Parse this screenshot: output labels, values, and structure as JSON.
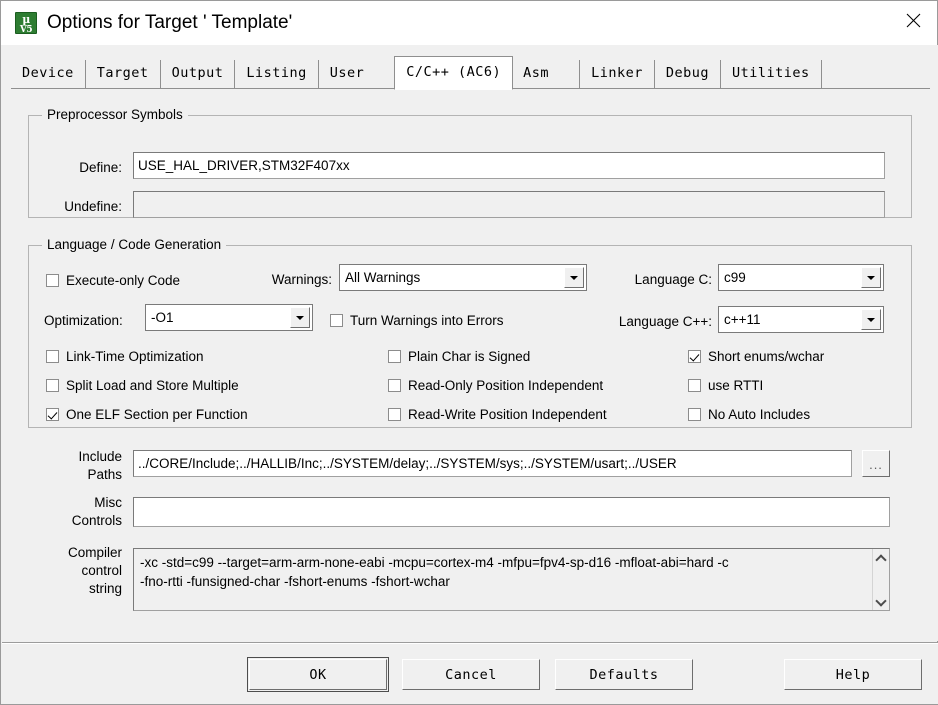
{
  "window": {
    "title": "Options for Target ' Template'",
    "app_icon": "keil-uvision-icon",
    "icon_line1": "µ",
    "icon_line2": "V5",
    "close_label": "✕"
  },
  "tabs": [
    {
      "label": "Device",
      "active": false
    },
    {
      "label": "Target",
      "active": false
    },
    {
      "label": "Output",
      "active": false
    },
    {
      "label": "Listing",
      "active": false
    },
    {
      "label": "User",
      "active": false
    },
    {
      "label": "C/C++ (AC6)",
      "active": true
    },
    {
      "label": "Asm",
      "active": false
    },
    {
      "label": "Linker",
      "active": false
    },
    {
      "label": "Debug",
      "active": false
    },
    {
      "label": "Utilities",
      "active": false
    }
  ],
  "preprocessor": {
    "legend": "Preprocessor Symbols",
    "define_label": "Define:",
    "define_value": "USE_HAL_DRIVER,STM32F407xx",
    "undefine_label": "Undefine:",
    "undefine_value": ""
  },
  "language": {
    "legend": "Language / Code Generation",
    "execute_only": {
      "label": "Execute-only Code",
      "checked": false
    },
    "optimization": {
      "label": "Optimization:",
      "value": "-O1"
    },
    "link_time_opt": {
      "label": "Link-Time Optimization",
      "checked": false
    },
    "split_load_store": {
      "label": "Split Load and Store Multiple",
      "checked": false
    },
    "one_elf_section": {
      "label": "One ELF Section per Function",
      "checked": true
    },
    "warnings": {
      "label": "Warnings:",
      "value": "All Warnings"
    },
    "warnings_errors": {
      "label": "Turn Warnings into Errors",
      "checked": false
    },
    "plain_char_signed": {
      "label": "Plain Char is Signed",
      "checked": false
    },
    "read_only_pi": {
      "label": "Read-Only Position Independent",
      "checked": false
    },
    "read_write_pi": {
      "label": "Read-Write Position Independent",
      "checked": false
    },
    "language_c": {
      "label": "Language C:",
      "value": "c99"
    },
    "language_cpp": {
      "label": "Language C++:",
      "value": "c++11"
    },
    "short_enums": {
      "label": "Short enums/wchar",
      "checked": true
    },
    "use_rtti": {
      "label": "use RTTI",
      "checked": false
    },
    "no_auto_includes": {
      "label": "No Auto Includes",
      "checked": false
    }
  },
  "paths": {
    "include_label_line1": "Include",
    "include_label_line2": "Paths",
    "include_value": "../CORE/Include;../HALLIB/Inc;../SYSTEM/delay;../SYSTEM/sys;../SYSTEM/usart;../USER",
    "browse_label": "...",
    "misc_label_line1": "Misc",
    "misc_label_line2": "Controls",
    "misc_value": ""
  },
  "compiler": {
    "label_line1": "Compiler",
    "label_line2": "control",
    "label_line3": "string",
    "value": "-xc -std=c99 --target=arm-arm-none-eabi -mcpu=cortex-m4 -mfpu=fpv4-sp-d16 -mfloat-abi=hard -c\n-fno-rtti -funsigned-char -fshort-enums -fshort-wchar",
    "scroll_up_icon": "chevron-up-icon",
    "scroll_down_icon": "chevron-down-icon"
  },
  "footer": {
    "ok": "OK",
    "cancel": "Cancel",
    "defaults": "Defaults",
    "help": "Help"
  },
  "colors": {
    "dialog_bg": "#f0f0f0",
    "titlebar_bg": "#ffffff",
    "field_bg": "#ffffff",
    "border": "#b4b4b4",
    "icon_green": "#2e7d32"
  }
}
